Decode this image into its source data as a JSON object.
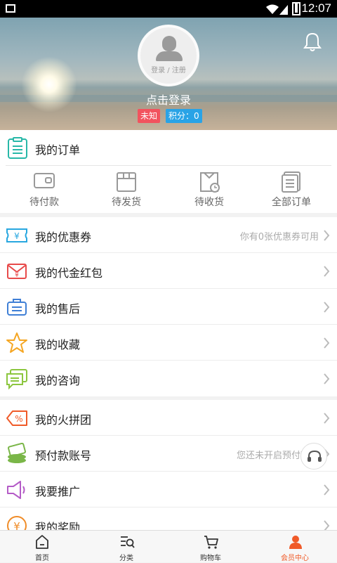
{
  "status_bar": {
    "time": "12:07"
  },
  "header": {
    "avatar_text": "登录 / 注册",
    "click_login": "点击登录",
    "badge_unknown": "未知",
    "points": "积分：0"
  },
  "orders": {
    "title": "我的订单",
    "items": [
      {
        "label": "待付款",
        "icon": "wallet-icon"
      },
      {
        "label": "待发货",
        "icon": "box-icon"
      },
      {
        "label": "待收货",
        "icon": "receive-icon"
      },
      {
        "label": "全部订单",
        "icon": "all-orders-icon"
      }
    ]
  },
  "menu1": [
    {
      "label": "我的优惠券",
      "hint": "你有0张优惠券可用",
      "icon": "coupon-icon",
      "color": "#28a7e0"
    },
    {
      "label": "我的代金红包",
      "hint": "",
      "icon": "red-packet-icon",
      "color": "#e84a4a"
    },
    {
      "label": "我的售后",
      "hint": "",
      "icon": "after-sale-icon",
      "color": "#3f7fd6"
    },
    {
      "label": "我的收藏",
      "hint": "",
      "icon": "star-icon",
      "color": "#f5a623"
    },
    {
      "label": "我的咨询",
      "hint": "",
      "icon": "chat-icon",
      "color": "#8cc63f"
    }
  ],
  "menu2": [
    {
      "label": "我的火拼团",
      "hint": "",
      "icon": "group-buy-icon",
      "color": "#f05a28"
    },
    {
      "label": "预付款账号",
      "hint": "您还未开启预付款账",
      "icon": "prepaid-icon",
      "color": "#7ab648"
    },
    {
      "label": "我要推广",
      "hint": "",
      "icon": "megaphone-icon",
      "color": "#b45bc7"
    },
    {
      "label": "我的奖励",
      "hint": "",
      "icon": "reward-icon",
      "color": "#f08c28"
    }
  ],
  "tabbar": [
    {
      "label": "首页",
      "icon": "home-icon"
    },
    {
      "label": "分类",
      "icon": "category-icon"
    },
    {
      "label": "购物车",
      "icon": "cart-icon"
    },
    {
      "label": "会员中心",
      "icon": "member-icon"
    }
  ],
  "colors": {
    "accent": "#f05a28",
    "unknown_badge": "#f2535e",
    "points_badge": "#29a3e6"
  }
}
